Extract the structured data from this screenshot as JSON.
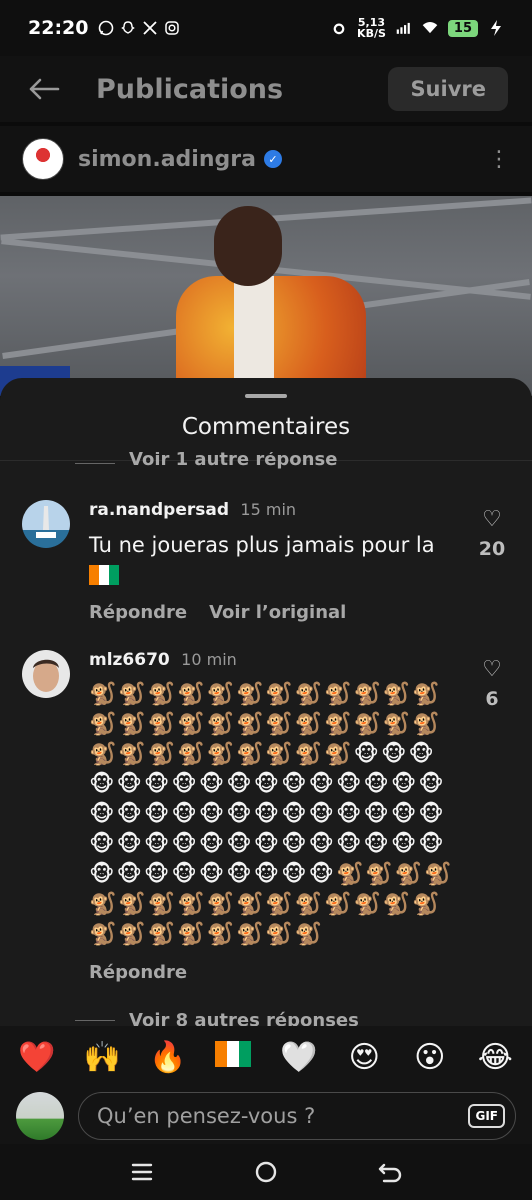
{
  "status_bar": {
    "time": "22:20",
    "notification_icons": [
      "whatsapp-icon",
      "snapchat-icon",
      "x-icon",
      "instagram-icon"
    ],
    "speed_value": "5,13",
    "speed_unit": "KB/S",
    "battery": "15"
  },
  "header": {
    "title": "Publications",
    "follow_label": "Suivre"
  },
  "post": {
    "author": "simon.adingra",
    "verified": true
  },
  "sheet": {
    "title": "Commentaires",
    "replies_top": "Voir 1 autre réponse",
    "replies_bottom": "Voir 8 autres réponses"
  },
  "comments": [
    {
      "username": "ra.nandpersad",
      "time": "15 min",
      "text": "Tu ne joueras plus jamais pour la",
      "likes": "20",
      "reply_label": "Répondre",
      "see_original_label": "Voir l’original"
    },
    {
      "username": "mlz6670",
      "time": "10 min",
      "text": "🐒🐒🐒🐒🐒🐒🐒🐒🐒🐒🐒🐒🐒🐒🐒🐒🐒🐒🐒🐒🐒🐒🐒🐒🐒🐒🐒🐒🐒🐒🐒🐒🐒🐵🐵🐵🐵🐵🐵🐵🐵🐵🐵🐵🐵🐵🐵🐵🐵🐵🐵🐵🐵🐵🐵🐵🐵🐵🐵🐵🐵🐵🐵🐵🐵🐵🐵🐵🐵🐵🐵🐵🐵🐵🐵🐵🐵🐵🐵🐵🐵🐵🐵🐵🐒🐒🐒🐒🐒🐒🐒🐒🐒🐒🐒🐒🐒🐒🐒🐒🐒🐒🐒🐒🐒🐒🐒🐒",
      "likes": "6",
      "reply_label": "Répondre"
    }
  ],
  "reactions": [
    "❤️",
    "🙌",
    "🔥",
    "ci-flag",
    "🤍",
    "😍",
    "😮",
    "😂"
  ],
  "composer": {
    "placeholder": "Qu’en pensez-vous ?",
    "gif_label": "GIF"
  },
  "colors": {
    "background": "#0b0b0b",
    "sheet": "#1b1b1b",
    "verified_blue": "#2d7be5",
    "flag_orange": "#f77f00",
    "flag_green": "#009e60"
  }
}
